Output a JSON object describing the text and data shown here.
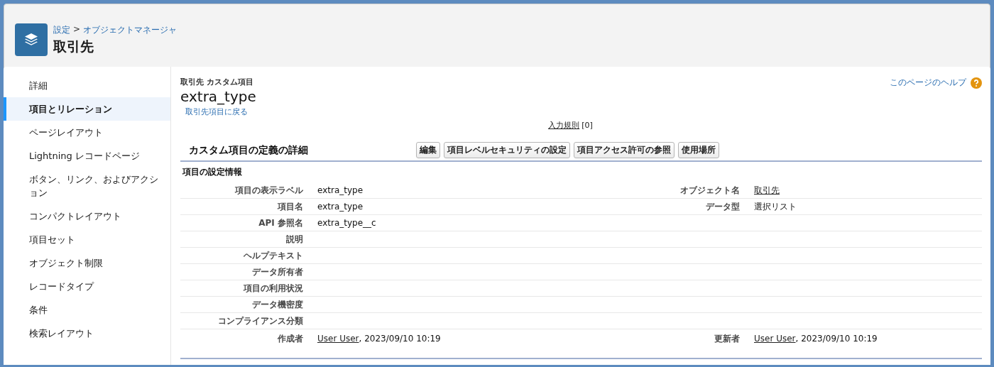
{
  "header": {
    "breadcrumb": [
      {
        "label": "設定"
      },
      {
        "label": "オブジェクトマネージャ"
      }
    ],
    "breadcrumb_separator": ">",
    "title": "取引先"
  },
  "sidebar": {
    "items": [
      {
        "label": "詳細",
        "selected": false
      },
      {
        "label": "項目とリレーション",
        "selected": true
      },
      {
        "label": "ページレイアウト",
        "selected": false
      },
      {
        "label": "Lightning レコードページ",
        "selected": false
      },
      {
        "label": "ボタン、リンク、およびアクション",
        "selected": false
      },
      {
        "label": "コンパクトレイアウト",
        "selected": false
      },
      {
        "label": "項目セット",
        "selected": false
      },
      {
        "label": "オブジェクト制限",
        "selected": false
      },
      {
        "label": "レコードタイプ",
        "selected": false
      },
      {
        "label": "条件",
        "selected": false
      },
      {
        "label": "検索レイアウト",
        "selected": false
      }
    ]
  },
  "content": {
    "subtitle": "取引先 カスタム項目",
    "title": "extra_type",
    "back_link": "取引先項目に戻る",
    "help_link": "このページのヘルプ",
    "related_link": {
      "label": "入力規則",
      "count": "[0]"
    },
    "section": {
      "title": "カスタム項目の定義の詳細",
      "buttons": [
        "編集",
        "項目レベルセキュリティの設定",
        "項目アクセス許可の参照",
        "使用場所"
      ],
      "subsection": "項目の設定情報",
      "rows": [
        {
          "left": {
            "label": "項目の表示ラベル",
            "text": "extra_type"
          },
          "right": {
            "label": "オブジェクト名",
            "link": "取引先"
          }
        },
        {
          "left": {
            "label": "項目名",
            "text": "extra_type"
          },
          "right": {
            "label": "データ型",
            "text": "選択リスト"
          }
        },
        {
          "left": {
            "label": "API 参照名",
            "text": "extra_type__c"
          }
        },
        {
          "left": {
            "label": "説明"
          }
        },
        {
          "left": {
            "label": "ヘルプテキスト"
          }
        },
        {
          "left": {
            "label": "データ所有者"
          }
        },
        {
          "left": {
            "label": "項目の利用状況"
          }
        },
        {
          "left": {
            "label": "データ機密度"
          }
        },
        {
          "left": {
            "label": "コンプライアンス分類"
          }
        },
        {
          "left": {
            "label": "作成者",
            "link": "User User",
            "text": ", 2023/09/10 10:19"
          },
          "right": {
            "label": "更新者",
            "link": "User User",
            "text": ", 2023/09/10 10:19"
          }
        }
      ]
    }
  }
}
